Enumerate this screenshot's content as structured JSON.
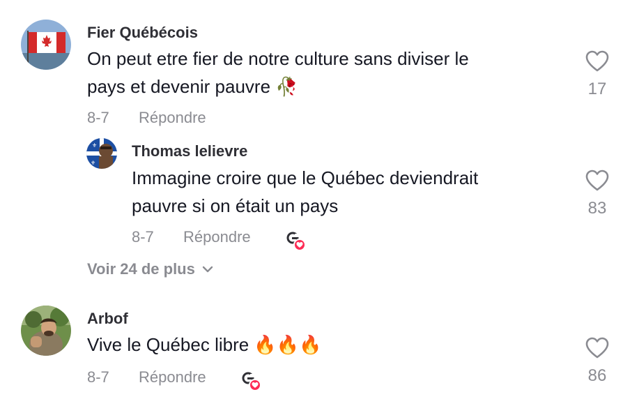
{
  "comments": [
    {
      "username": "Fier Québécois",
      "text_line1": "On peut etre fier de notre culture sans diviser le",
      "text_line2": "pays et devenir pauvre 🥀",
      "date": "8-7",
      "reply_label": "Répondre",
      "likes": "17",
      "avatar": "canada-flag-avatar",
      "replies": [
        {
          "username": "Thomas lelievre",
          "text_line1": "Immagine croire que le Québec deviendrait",
          "text_line2": "pauvre si on était un pays",
          "date": "8-7",
          "reply_label": "Répondre",
          "likes": "83",
          "avatar": "quebec-flag-avatar",
          "creator_liked": true
        }
      ],
      "view_more_label": "Voir 24 de plus"
    },
    {
      "username": "Arbof",
      "text_line1": "Vive le Québec libre 🔥🔥🔥",
      "date": "8-7",
      "reply_label": "Répondre",
      "likes": "86",
      "avatar": "person-photo-avatar",
      "creator_liked": true
    }
  ],
  "colors": {
    "text": "#161823",
    "username": "#2f2f35",
    "secondary": "#8a8b91",
    "like_badge": "#fe2c55"
  }
}
